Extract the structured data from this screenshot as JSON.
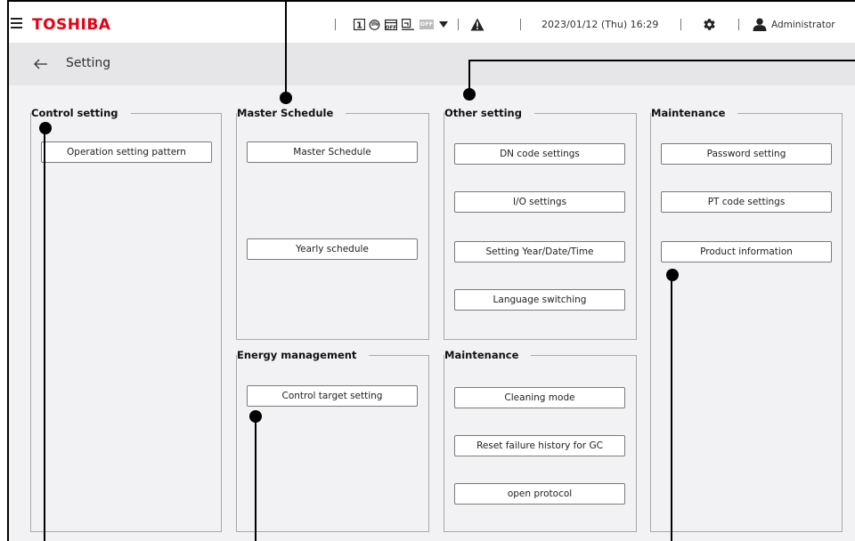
{
  "header": {
    "brand": "TOSHIBA",
    "datetime": "2023/01/12 (Thu) 16:29",
    "user": "Administrator",
    "status_icons": [
      "schedule-1-icon",
      "hand-icon",
      "calendar-off-icon",
      "timer-off-icon",
      "off-badge-icon",
      "dropdown-icon",
      "alert-icon"
    ],
    "off_badge": "OFF"
  },
  "titlebar": {
    "title": "Setting"
  },
  "sections": {
    "control_setting": {
      "title": "Control setting",
      "buttons": [
        "Operation setting pattern"
      ]
    },
    "master_schedule": {
      "title": "Master Schedule",
      "buttons": [
        "Master Schedule",
        "Yearly schedule"
      ]
    },
    "energy_management": {
      "title": "Energy management",
      "buttons": [
        "Control target setting"
      ]
    },
    "other_setting": {
      "title": "Other setting",
      "buttons": [
        "DN code settings",
        "I/O settings",
        "Setting Year/Date/Time",
        "Language switching"
      ]
    },
    "maintenance_lower": {
      "title": "Maintenance",
      "buttons": [
        "Cleaning mode",
        "Reset failure history for GC",
        "open protocol"
      ]
    },
    "maintenance_right": {
      "title": "Maintenance",
      "buttons": [
        "Password setting",
        "PT code settings",
        "Product information"
      ]
    }
  }
}
